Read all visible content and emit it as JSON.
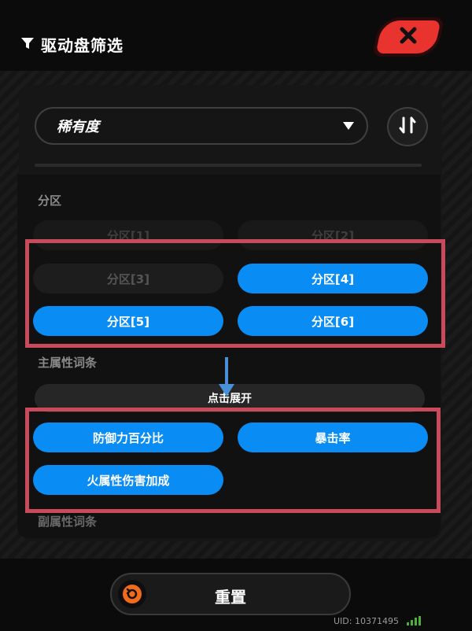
{
  "header": {
    "title": "驱动盘筛选"
  },
  "sort": {
    "label": "稀有度"
  },
  "sections": {
    "partition": {
      "label": "分区",
      "items": [
        {
          "label": "分区[1]",
          "selected": false
        },
        {
          "label": "分区[2]",
          "selected": false
        },
        {
          "label": "分区[3]",
          "selected": false
        },
        {
          "label": "分区[4]",
          "selected": true
        },
        {
          "label": "分区[5]",
          "selected": true
        },
        {
          "label": "分区[6]",
          "selected": true
        }
      ]
    },
    "main_stat": {
      "label": "主属性词条",
      "expand_label": "点击展开",
      "items": [
        {
          "label": "防御力百分比",
          "selected": true
        },
        {
          "label": "暴击率",
          "selected": true
        },
        {
          "label": "火属性伤害加成",
          "selected": true
        }
      ]
    },
    "sub_stat": {
      "label": "副属性词条"
    }
  },
  "footer": {
    "reset_label": "重置",
    "uid": "UID: 10371495"
  },
  "colors": {
    "selected": "#0a8cf5",
    "close": "#e8332f",
    "highlight": "#c94a5a",
    "arrow": "#4a90d9",
    "reset_icon": "#f26b1d"
  }
}
